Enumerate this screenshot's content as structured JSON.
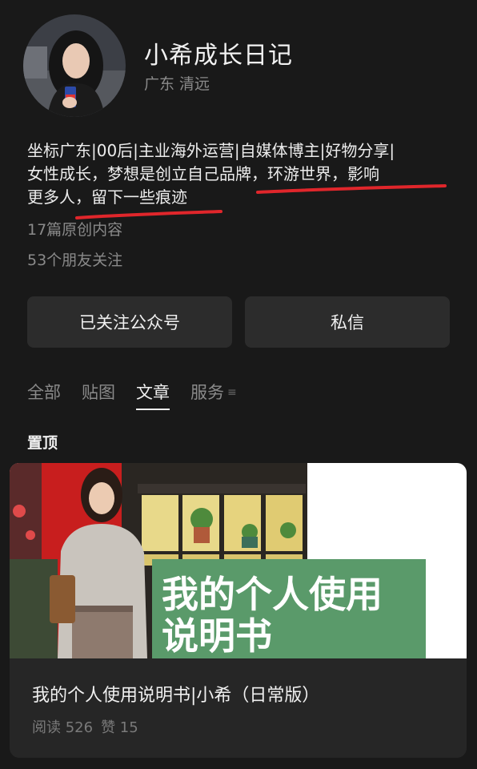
{
  "profile": {
    "name": "小希成长日记",
    "location": "广东 清远",
    "bio_lines": [
      "坐标广东|00后|主业海外运营|自媒体博主|好物分享|",
      "女性成长，梦想是创立自己品牌，环游世界，影响",
      "更多人，留下一些痕迹"
    ],
    "articles_count": "17篇原创内容",
    "followers": "53个朋友关注"
  },
  "actions": {
    "follow_label": "已关注公众号",
    "message_label": "私信"
  },
  "tabs": [
    {
      "label": "全部",
      "active": false
    },
    {
      "label": "贴图",
      "active": false
    },
    {
      "label": "文章",
      "active": true
    },
    {
      "label": "服务",
      "active": false
    }
  ],
  "tab_menu_icon": "≡",
  "pinned": {
    "section_label": "置顶",
    "thumbnail_text": [
      "我的个人使用",
      "说明书"
    ],
    "title": "我的个人使用说明书|小希（日常版）",
    "reads": "阅读 526",
    "likes": "赞 15"
  },
  "colors": {
    "background": "#191919",
    "card": "#262626",
    "button": "#2c2c2c",
    "annotation": "#e0262b",
    "thumb_banner": "#5a9a6a"
  }
}
